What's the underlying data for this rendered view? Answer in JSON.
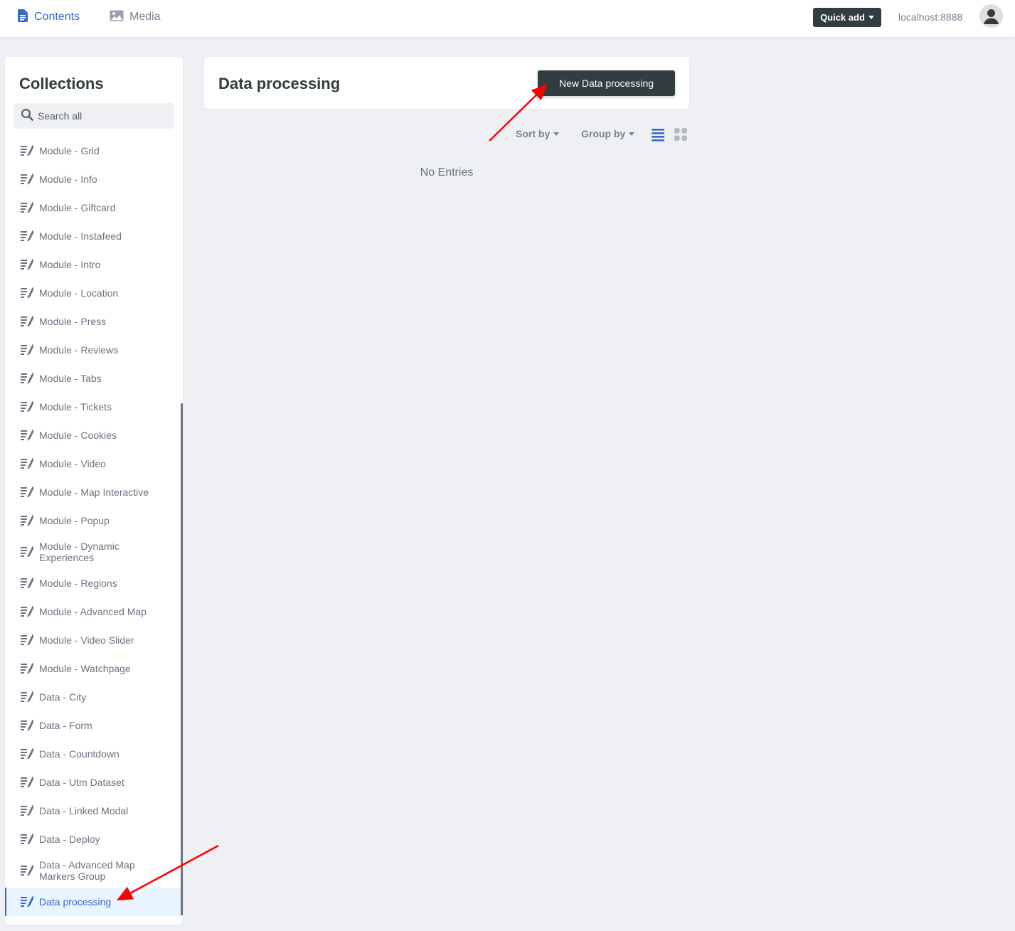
{
  "topbar": {
    "tabs": [
      {
        "label": "Contents",
        "icon": "document-icon",
        "active": true
      },
      {
        "label": "Media",
        "icon": "image-icon",
        "active": false
      }
    ],
    "quick_add_label": "Quick add",
    "site_url": "localhost:8888"
  },
  "sidebar": {
    "title": "Collections",
    "search_placeholder": "Search all",
    "items": [
      {
        "label": "Module - Grid"
      },
      {
        "label": "Module - Info"
      },
      {
        "label": "Module - Giftcard"
      },
      {
        "label": "Module - Instafeed"
      },
      {
        "label": "Module - Intro"
      },
      {
        "label": "Module - Location"
      },
      {
        "label": "Module - Press"
      },
      {
        "label": "Module - Reviews"
      },
      {
        "label": "Module - Tabs"
      },
      {
        "label": "Module - Tickets"
      },
      {
        "label": "Module - Cookies"
      },
      {
        "label": "Module - Video"
      },
      {
        "label": "Module - Map Interactive"
      },
      {
        "label": "Module - Popup"
      },
      {
        "label": "Module - Dynamic Experiences"
      },
      {
        "label": "Module - Regions"
      },
      {
        "label": "Module - Advanced Map"
      },
      {
        "label": "Module - Video Slider"
      },
      {
        "label": "Module - Watchpage"
      },
      {
        "label": "Data - City"
      },
      {
        "label": "Data - Form"
      },
      {
        "label": "Data - Countdown"
      },
      {
        "label": "Data - Utm Dataset"
      },
      {
        "label": "Data - Linked Modal"
      },
      {
        "label": "Data - Deploy"
      },
      {
        "label": "Data - Advanced Map Markers Group"
      },
      {
        "label": "Data processing",
        "active": true
      }
    ]
  },
  "main": {
    "title": "Data processing",
    "new_button_label": "New Data processing",
    "sort_by_label": "Sort by",
    "group_by_label": "Group by",
    "empty_message": "No Entries"
  },
  "colors": {
    "accent": "#3a69c7",
    "dark_button": "#313d3e",
    "annotation_arrow": "#ff0000"
  }
}
